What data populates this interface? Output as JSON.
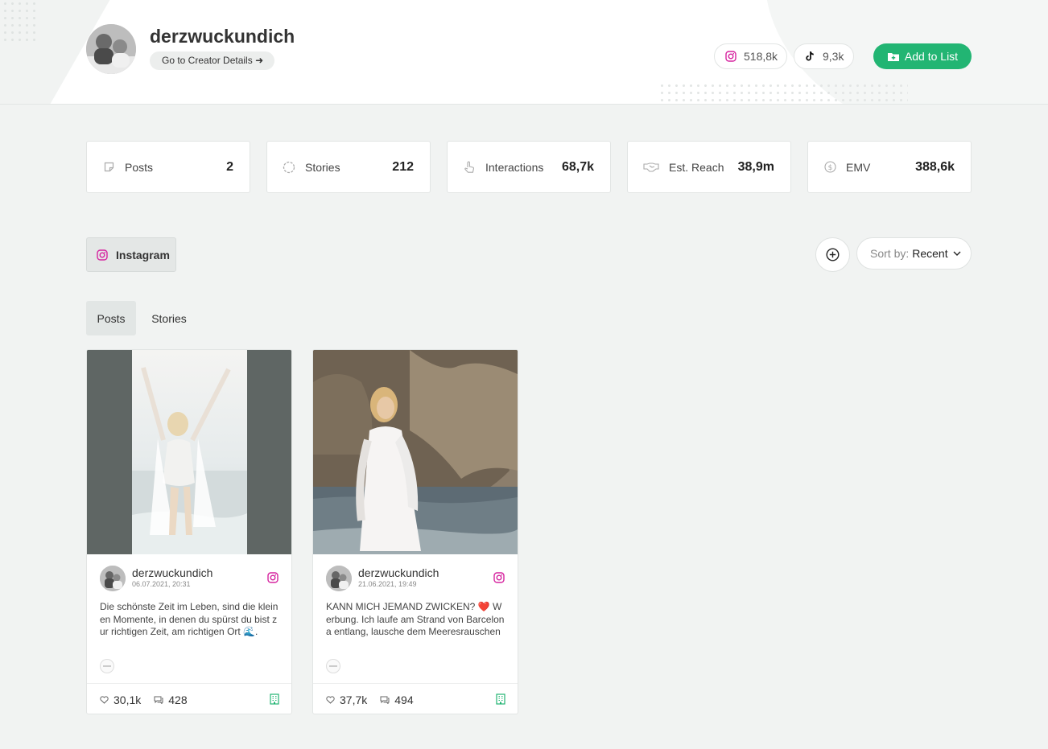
{
  "header": {
    "creator_name": "derzwuckundich",
    "creator_link": "Go to Creator Details",
    "instagram_followers": "518,8k",
    "tiktok_followers": "9,3k",
    "add_to_list": "Add to List"
  },
  "stats": [
    {
      "label": "Posts",
      "value": "2",
      "icon": "post-icon"
    },
    {
      "label": "Stories",
      "value": "212",
      "icon": "stories-icon"
    },
    {
      "label": "Interactions",
      "value": "68,7k",
      "icon": "hand-pointer-icon"
    },
    {
      "label": "Est. Reach",
      "value": "38,9m",
      "icon": "handshake-icon"
    },
    {
      "label": "EMV",
      "value": "388,6k",
      "icon": "dollar-icon"
    }
  ],
  "filters": {
    "platform": "Instagram",
    "sort_label": "Sort by:",
    "sort_value": "Recent"
  },
  "tabs": [
    {
      "label": "Posts",
      "active": true
    },
    {
      "label": "Stories",
      "active": false
    }
  ],
  "posts": [
    {
      "username": "derzwuckundich",
      "date": "06.07.2021, 20:31",
      "caption": "Die schönste Zeit im Leben, sind die kleinen Momente, in denen du spürst du bist zur richtigen Zeit, am richtigen Ort 🌊. W…",
      "likes": "30,1k",
      "comments": "428"
    },
    {
      "username": "derzwuckundich",
      "date": "21.06.2021, 19:49",
      "caption": "KANN MICH JEMAND ZWICKEN? ❤️ Werbung. Ich laufe am Strand von Barcelona entlang, lausche dem Meeresrauschen u…",
      "likes": "37,7k",
      "comments": "494"
    }
  ],
  "colors": {
    "accent_green": "#22b573",
    "instagram_pink": "#d6249f",
    "page_bg": "#f1f3f2"
  }
}
